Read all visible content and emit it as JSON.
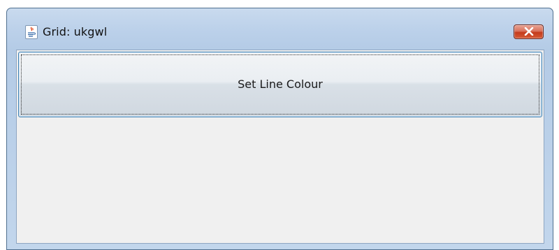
{
  "window": {
    "title": "Grid: ukgwl",
    "app_icon": "java-icon",
    "close_icon": "close-icon"
  },
  "main": {
    "button_label": "Set Line Colour"
  },
  "colors": {
    "button_border": "#3c7fb1",
    "close_button": "#c43b1c",
    "client_bg": "#f0f0f0"
  }
}
